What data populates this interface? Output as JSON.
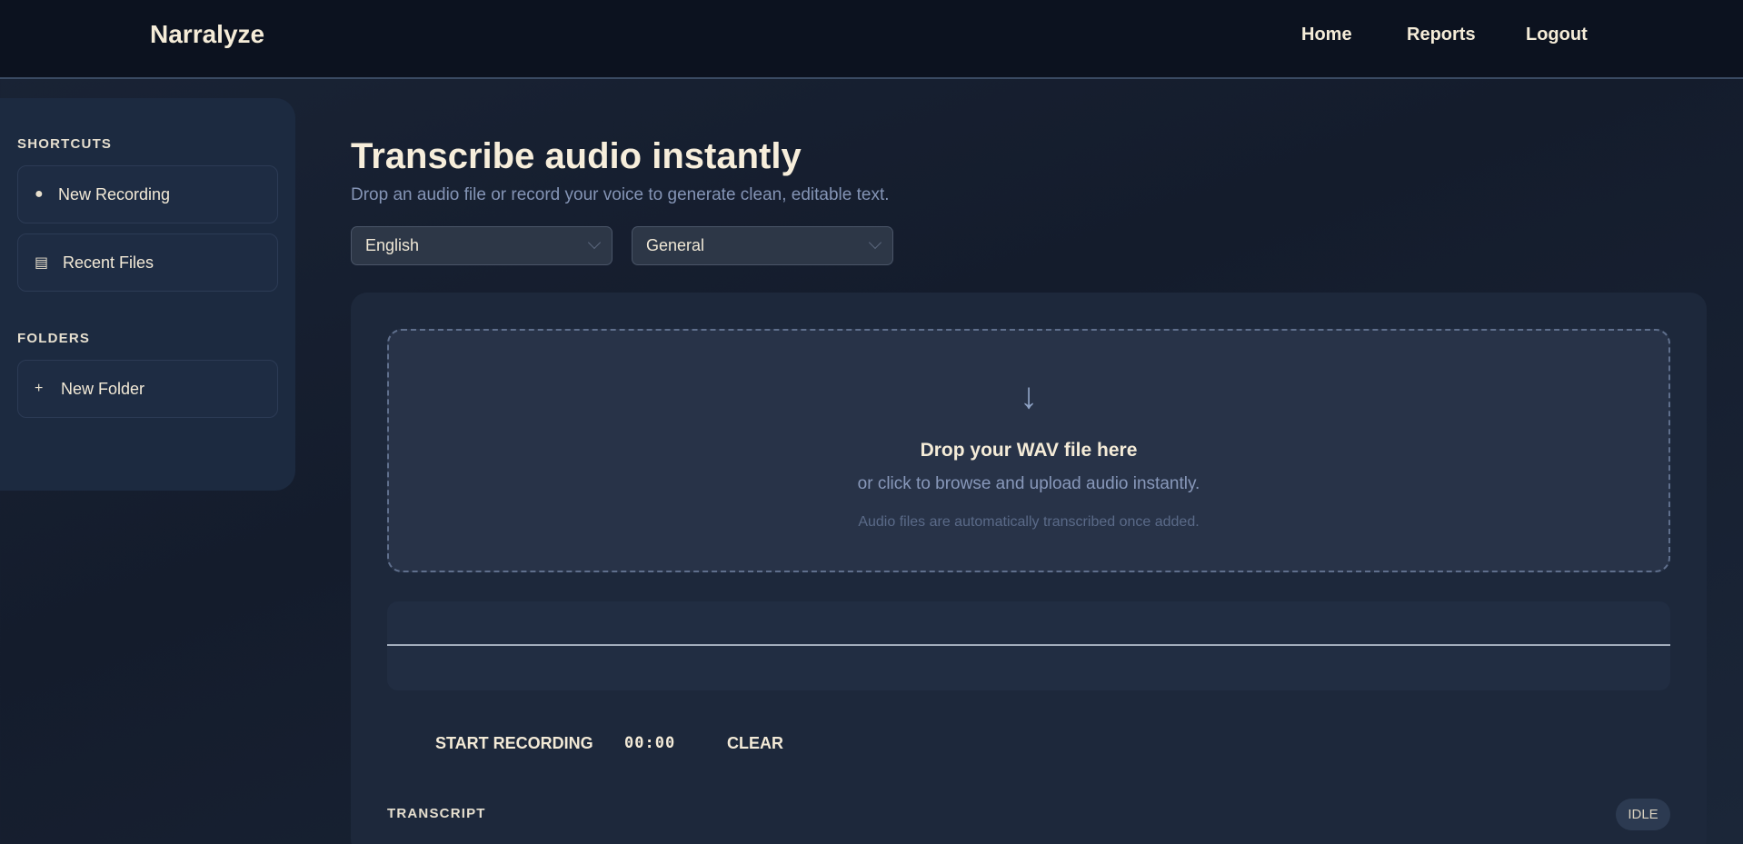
{
  "header": {
    "brand": "Narralyze",
    "nav": [
      {
        "label": "Home"
      },
      {
        "label": "Reports"
      },
      {
        "label": "Logout"
      }
    ]
  },
  "sidebar": {
    "shortcuts_heading": "SHORTCUTS",
    "shortcuts": [
      {
        "label": "New Recording",
        "icon": "●",
        "icon_name": "record-dot-icon"
      },
      {
        "label": "Recent Files",
        "icon": "▤",
        "icon_name": "list-icon"
      }
    ],
    "folders_heading": "FOLDERS",
    "folders": [
      {
        "label": "New Folder",
        "icon": "+",
        "icon_name": "plus-icon"
      }
    ]
  },
  "main": {
    "title": "Transcribe audio instantly",
    "subtitle": "Drop an audio file or record your voice to generate clean, editable text.",
    "language_select": {
      "value": "English"
    },
    "mode_select": {
      "value": "General"
    },
    "dropzone": {
      "icon": "↓",
      "title": "Drop your WAV file here",
      "subtitle": "or click to browse and upload audio instantly.",
      "note": "Audio files are automatically transcribed once added."
    },
    "controls": {
      "start_label": "START RECORDING",
      "timer": "00:00",
      "clear_label": "CLEAR"
    },
    "transcript": {
      "label": "TRANSCRIPT",
      "status": "IDLE"
    }
  },
  "colors": {
    "header_bg": "#0c121f",
    "panel_bg": "#1d283b",
    "text_cream": "#f3ead7",
    "muted_blue": "#8494b5"
  }
}
